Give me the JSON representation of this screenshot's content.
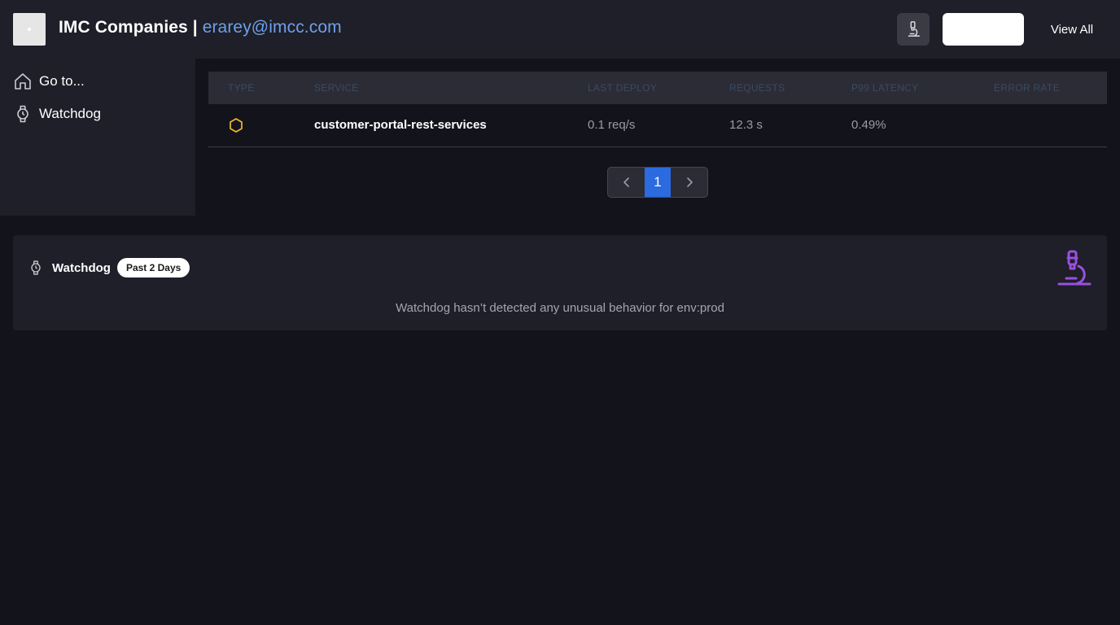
{
  "header": {
    "company": "IMC Companies",
    "separator": "|",
    "email": "erarey@imcc.com",
    "microscope_button_icon": "microscope-icon",
    "blank_button_label": "",
    "view_all_label": "View All"
  },
  "sidebar": {
    "items": [
      {
        "label": "Go to...",
        "icon": "home-icon"
      },
      {
        "label": "Watchdog",
        "icon": "watch-icon"
      }
    ]
  },
  "table": {
    "columns": [
      "TYPE",
      "SERVICE",
      "LAST DEPLOY",
      "REQUESTS",
      "P99 LATENCY",
      "ERROR RATE"
    ],
    "rows": [
      {
        "type_icon": "hexagon-icon",
        "service": "customer-portal-rest-services",
        "last_deploy": "0.1 req/s",
        "requests": "12.3 s",
        "p99_latency": "0.49%",
        "error_rate": ""
      }
    ]
  },
  "pagination": {
    "current_page": "1",
    "prev_icon": "chevron-left-icon",
    "next_icon": "chevron-right-icon"
  },
  "watchdog_panel": {
    "title": "Watchdog",
    "badge": "Past 2 Days",
    "message": "Watchdog hasn’t detected any unusual behavior for env:prod",
    "illustration_icon": "microscope-icon"
  },
  "colors": {
    "background": "#13141b",
    "surface": "#1e1f28",
    "accent_blue": "#2c6ae0",
    "email_blue": "#6ea0ea",
    "hexagon_yellow": "#f5b82e",
    "illustration_purple": "#9b4fe0"
  }
}
